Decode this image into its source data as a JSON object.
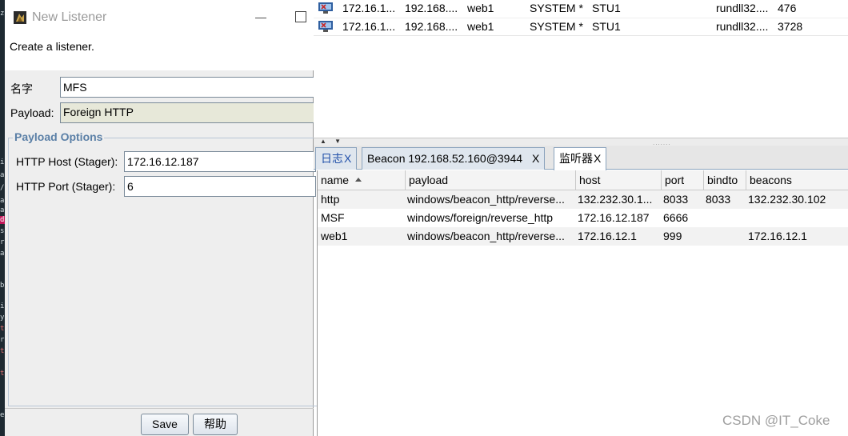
{
  "dialog": {
    "title": "New Listener",
    "minimize_glyph": "—",
    "description": "Create a listener.",
    "name_label": "名字",
    "name_value": "MFS",
    "payload_label": "Payload:",
    "payload_value": "Foreign HTTP",
    "group_title": "Payload Options",
    "host_label": "HTTP Host (Stager):",
    "host_value": "172.16.12.187",
    "port_label": "HTTP Port (Stager):",
    "port_value": "6",
    "save_label": "Save",
    "help_label": "帮助"
  },
  "beacons": [
    {
      "external": "172.16.1...",
      "internal": "192.168....",
      "computer": "web1",
      "user": "SYSTEM *",
      "listener": "STU1",
      "process": "rundll32....",
      "pid": "476"
    },
    {
      "external": "172.16.1...",
      "internal": "192.168....",
      "computer": "web1",
      "user": "SYSTEM *",
      "listener": "STU1",
      "process": "rundll32....",
      "pid": "3728"
    }
  ],
  "split": {
    "arrows": "▲ ▼",
    "grip": "......."
  },
  "tabs": [
    {
      "label": "日志",
      "close": "X"
    },
    {
      "label": "Beacon 192.168.52.160@3944",
      "close": "X"
    },
    {
      "label": "监听器",
      "close": "X"
    }
  ],
  "listeners": {
    "columns": [
      "name",
      "payload",
      "host",
      "port",
      "bindto",
      "beacons"
    ],
    "rows": [
      {
        "name": "http",
        "payload": "windows/beacon_http/reverse...",
        "host": "132.232.30.1...",
        "port": "8033",
        "bindto": "8033",
        "beacons": "132.232.30.102"
      },
      {
        "name": "MSF",
        "payload": "windows/foreign/reverse_http",
        "host": "172.16.12.187",
        "port": "6666",
        "bindto": "",
        "beacons": ""
      },
      {
        "name": "web1",
        "payload": "windows/beacon_http/reverse...",
        "host": "172.16.12.1",
        "port": "999",
        "bindto": "",
        "beacons": "172.16.12.1"
      }
    ]
  },
  "terminal_glyphs": [
    "z",
    "i",
    "a",
    "/",
    "a",
    "a",
    "d",
    "s",
    "r",
    "a",
    "b",
    "i",
    "y",
    "t",
    "r",
    "t",
    "t",
    "e"
  ],
  "watermark": "CSDN @IT_Coke",
  "colors": {
    "accent_blue": "#1f4ea8",
    "group_title": "#5a7fa6",
    "payload_field_bg": "#e7e8d9"
  }
}
